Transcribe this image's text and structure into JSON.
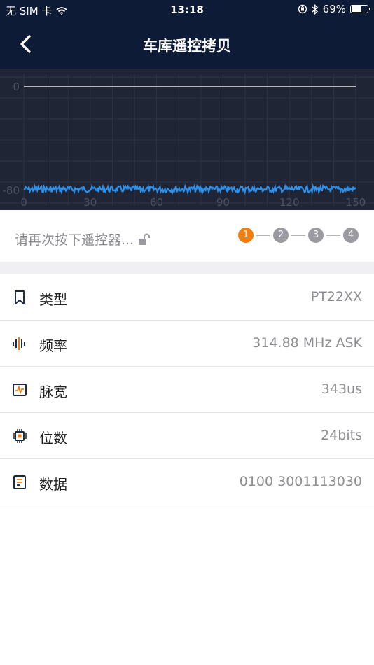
{
  "status_bar": {
    "carrier": "无 SIM 卡",
    "time": "13:18",
    "battery_percent": "69%",
    "battery_level": 0.69,
    "icons": [
      "wifi-icon",
      "orientation-lock-icon",
      "bluetooth-icon",
      "battery-icon"
    ]
  },
  "nav": {
    "title": "车库遥控拷贝",
    "back_icon": "chevron-left-icon"
  },
  "chart_data": {
    "type": "line",
    "xlabel": "",
    "ylabel": "",
    "x_ticks": [
      "0",
      "30",
      "60",
      "90",
      "120",
      "150"
    ],
    "y_ticks": [
      "0",
      "-80"
    ],
    "xlim": [
      0,
      150
    ],
    "ylim": [
      -80,
      0
    ],
    "grid": true,
    "series": [
      {
        "values": [
          0,
          0
        ],
        "x": [
          0,
          150
        ]
      },
      {
        "values": [
          -79,
          -79
        ],
        "x": [
          0,
          150
        ]
      }
    ],
    "colors": {
      "background": "#1f2535",
      "line_top": "#e8e8e8",
      "signal": "#2f8fe6",
      "grid": "#2c3346",
      "ticks": "#4a5163"
    }
  },
  "progress": {
    "hint": "请再次按下遥控器...",
    "steps": [
      "1",
      "2",
      "3",
      "4"
    ],
    "active_step": 1,
    "colors": {
      "active": "#ee7d12",
      "inactive": "#9a9aa0"
    }
  },
  "info": [
    {
      "icon": "bookmark-icon",
      "label": "类型",
      "value": "PT22XX"
    },
    {
      "icon": "frequency-bars-icon",
      "label": "频率",
      "value": "314.88 MHz ASK"
    },
    {
      "icon": "pulse-monitor-icon",
      "label": "脉宽",
      "value": "343us"
    },
    {
      "icon": "chip-icon",
      "label": "位数",
      "value": "24bits"
    },
    {
      "icon": "document-icon",
      "label": "数据",
      "value": "0100 3001113030"
    }
  ]
}
